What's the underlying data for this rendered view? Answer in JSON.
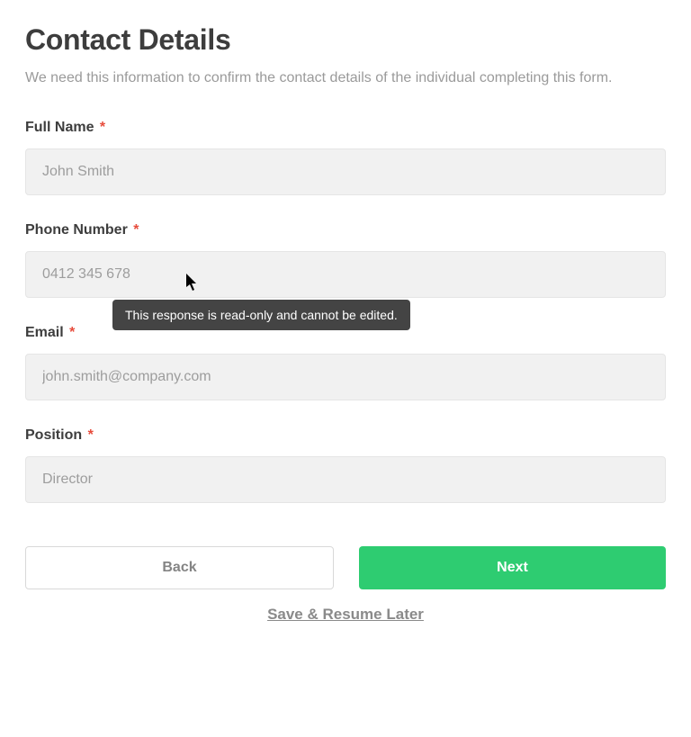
{
  "header": {
    "title": "Contact Details",
    "subtitle": "We need this information to confirm the contact details of the individual completing this form."
  },
  "fields": {
    "full_name": {
      "label": "Full Name",
      "required": "*",
      "placeholder": "John Smith"
    },
    "phone": {
      "label": "Phone Number",
      "required": "*",
      "placeholder": "0412 345 678"
    },
    "email": {
      "label": "Email",
      "required": "*",
      "placeholder": "john.smith@company.com"
    },
    "position": {
      "label": "Position",
      "required": "*",
      "placeholder": "Director"
    }
  },
  "tooltip": "This response is read-only and cannot be edited.",
  "buttons": {
    "back": "Back",
    "next": "Next",
    "save": "Save & Resume Later"
  }
}
